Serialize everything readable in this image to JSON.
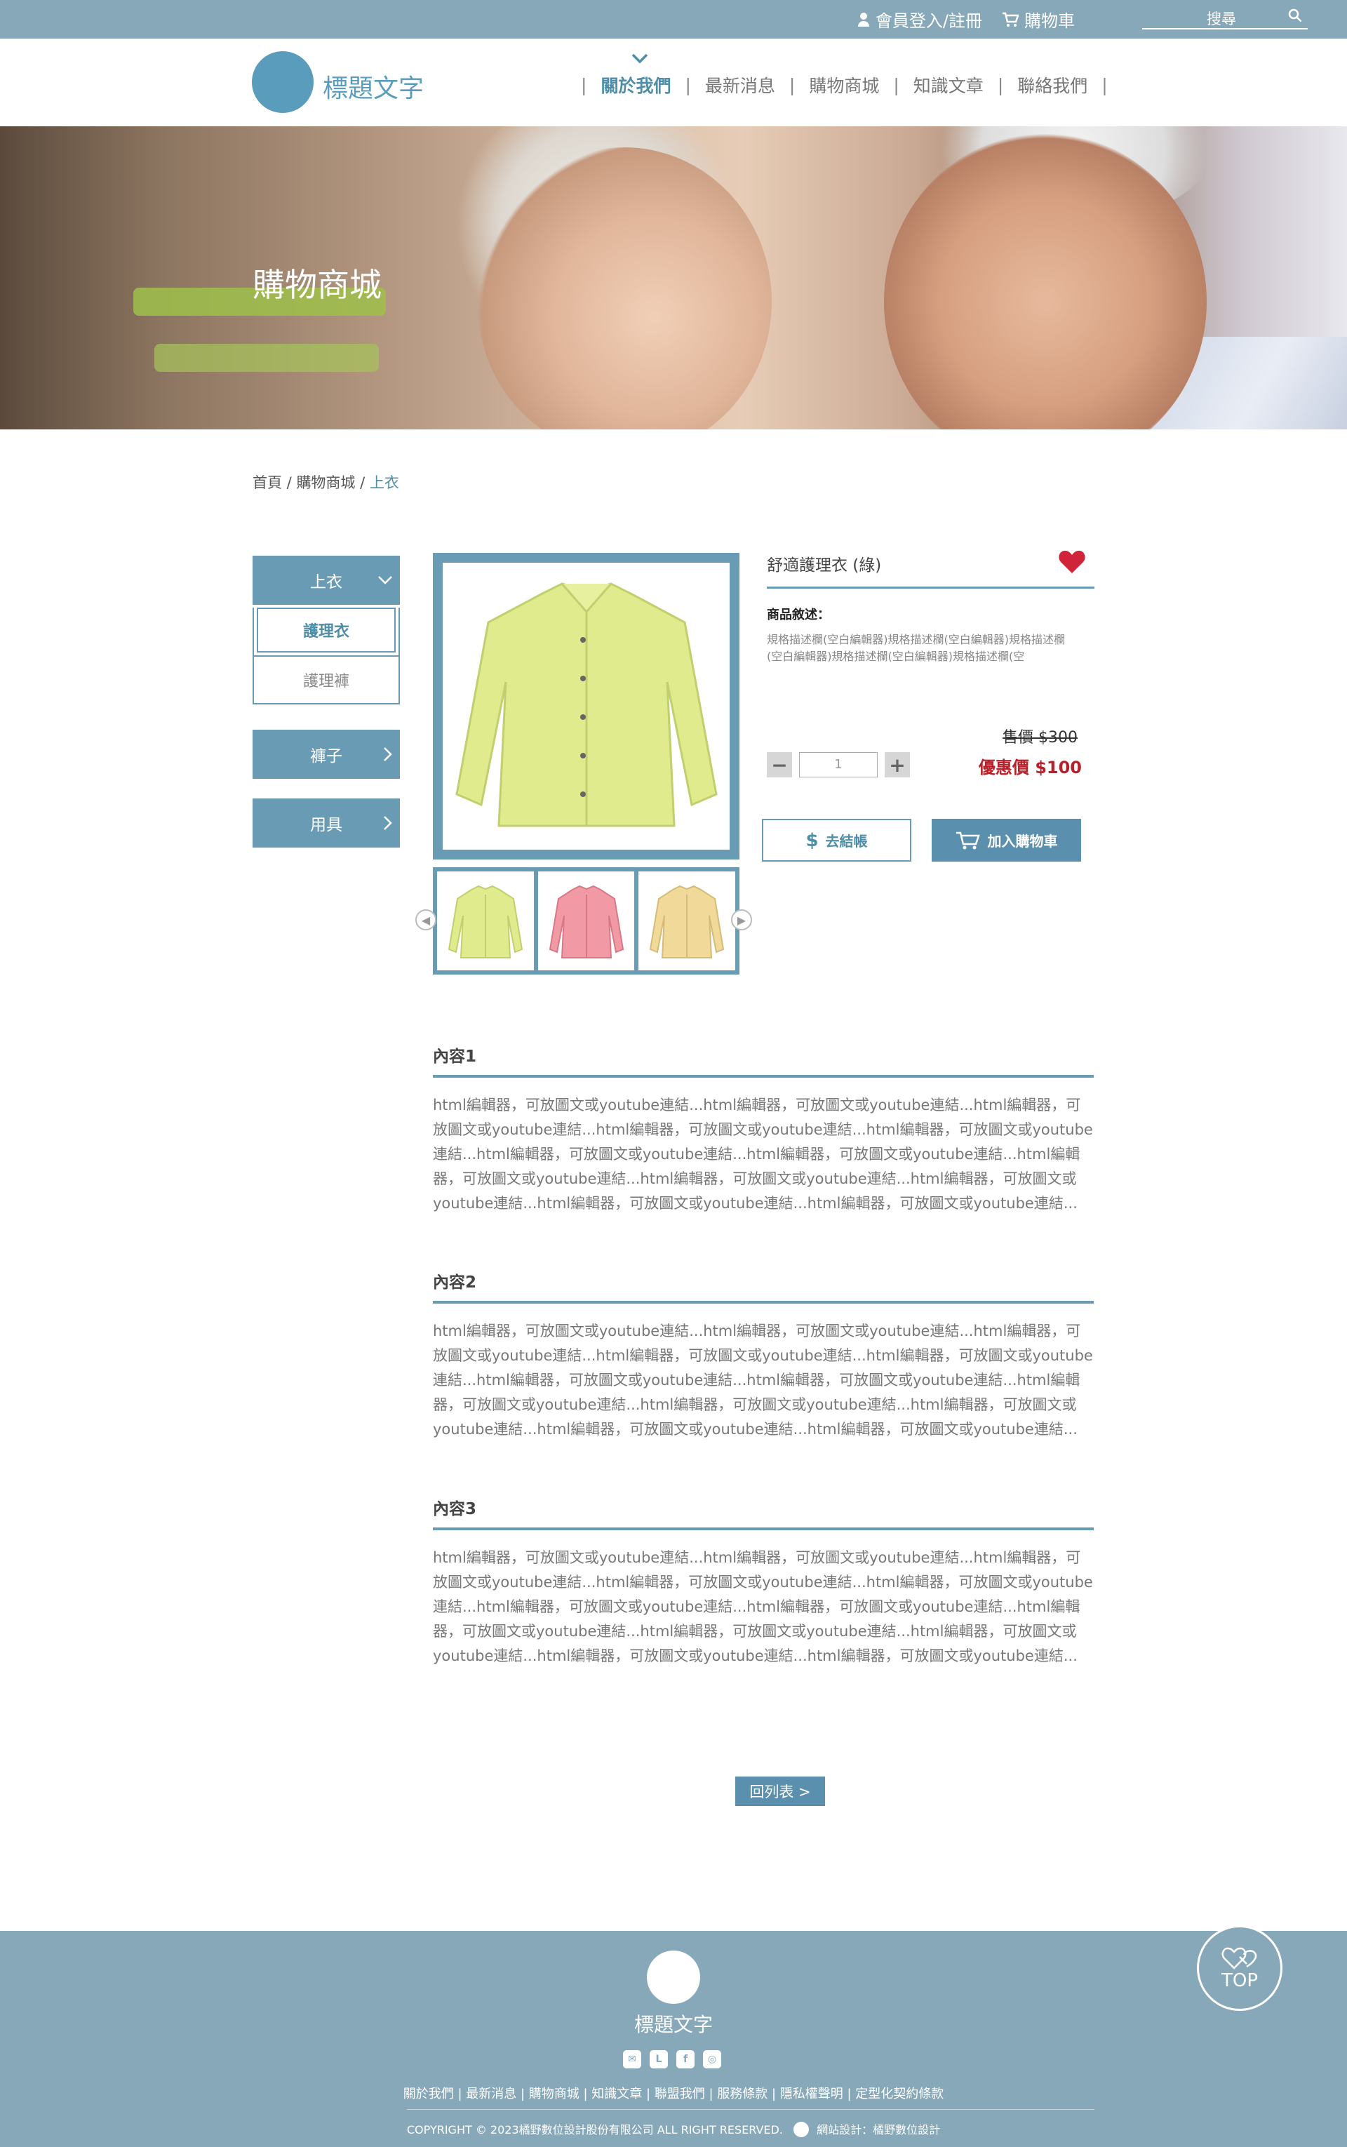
{
  "topbar": {
    "login_label": "會員登入/註冊",
    "cart_label": "購物車",
    "search_placeholder": "搜尋"
  },
  "header": {
    "logo_text": "標題文字",
    "nav": [
      "關於我們",
      "最新消息",
      "購物商城",
      "知識文章",
      "聯絡我們"
    ]
  },
  "hero": {
    "title": "購物商城"
  },
  "breadcrumb": {
    "home": "首頁",
    "shop": "購物商城",
    "current": "上衣"
  },
  "sidebar": {
    "cat1": "上衣",
    "sub1": "護理衣",
    "sub2": "護理褲",
    "cat2": "褲子",
    "cat3": "用具"
  },
  "product": {
    "name": "舒適護理衣 (綠)",
    "desc_title": "商品敘述：",
    "desc_text": "規格描述欄(空白編輯器)規格描述欄(空白編輯器)規格描述欄(空白編輯器)規格描述欄(空白編輯器)規格描述欄(空",
    "orig_price": "售價 $300",
    "sale_price": "優惠價 $100",
    "qty": "1",
    "checkout_label": "去結帳",
    "add_cart_label": "加入購物車"
  },
  "sections": [
    {
      "title": "內容1",
      "body": "html編輯器，可放圖文或youtube連結...html編輯器，可放圖文或youtube連結...html編輯器，可放圖文或youtube連結...html編輯器，可放圖文或youtube連結...html編輯器，可放圖文或youtube連結...html編輯器，可放圖文或youtube連結...html編輯器，可放圖文或youtube連結...html編輯器，可放圖文或youtube連結...html編輯器，可放圖文或youtube連結...html編輯器，可放圖文或youtube連結...html編輯器，可放圖文或youtube連結...html編輯器，可放圖文或youtube連結..."
    },
    {
      "title": "內容2",
      "body": "html編輯器，可放圖文或youtube連結...html編輯器，可放圖文或youtube連結...html編輯器，可放圖文或youtube連結...html編輯器，可放圖文或youtube連結...html編輯器，可放圖文或youtube連結...html編輯器，可放圖文或youtube連結...html編輯器，可放圖文或youtube連結...html編輯器，可放圖文或youtube連結...html編輯器，可放圖文或youtube連結...html編輯器，可放圖文或youtube連結...html編輯器，可放圖文或youtube連結...html編輯器，可放圖文或youtube連結..."
    },
    {
      "title": "內容3",
      "body": "html編輯器，可放圖文或youtube連結...html編輯器，可放圖文或youtube連結...html編輯器，可放圖文或youtube連結...html編輯器，可放圖文或youtube連結...html編輯器，可放圖文或youtube連結...html編輯器，可放圖文或youtube連結...html編輯器，可放圖文或youtube連結...html編輯器，可放圖文或youtube連結...html編輯器，可放圖文或youtube連結...html編輯器，可放圖文或youtube連結...html編輯器，可放圖文或youtube連結...html編輯器，可放圖文或youtube連結..."
    }
  ],
  "back_label": "回列表 >",
  "footer": {
    "title": "標題文字",
    "links": "關於我們 | 最新消息 | 購物商城 | 知識文章 | 聯盟我們 | 服務條款 | 隱私權聲明 | 定型化契約條款",
    "copyright": "COPYRIGHT © 2023橘野數位設計股份有限公司 ALL RIGHT RESERVED.",
    "designer": "網站設計：橘野數位設計",
    "top_label": "TOP"
  },
  "colors": {
    "brand": "#87a8b9",
    "accent": "#5a90ad",
    "sale": "#b8202a",
    "heart": "#d0243a",
    "shirt_green": "#dfeb8c",
    "shirt_pink": "#f19aa6",
    "shirt_yellow": "#f1d99a"
  }
}
